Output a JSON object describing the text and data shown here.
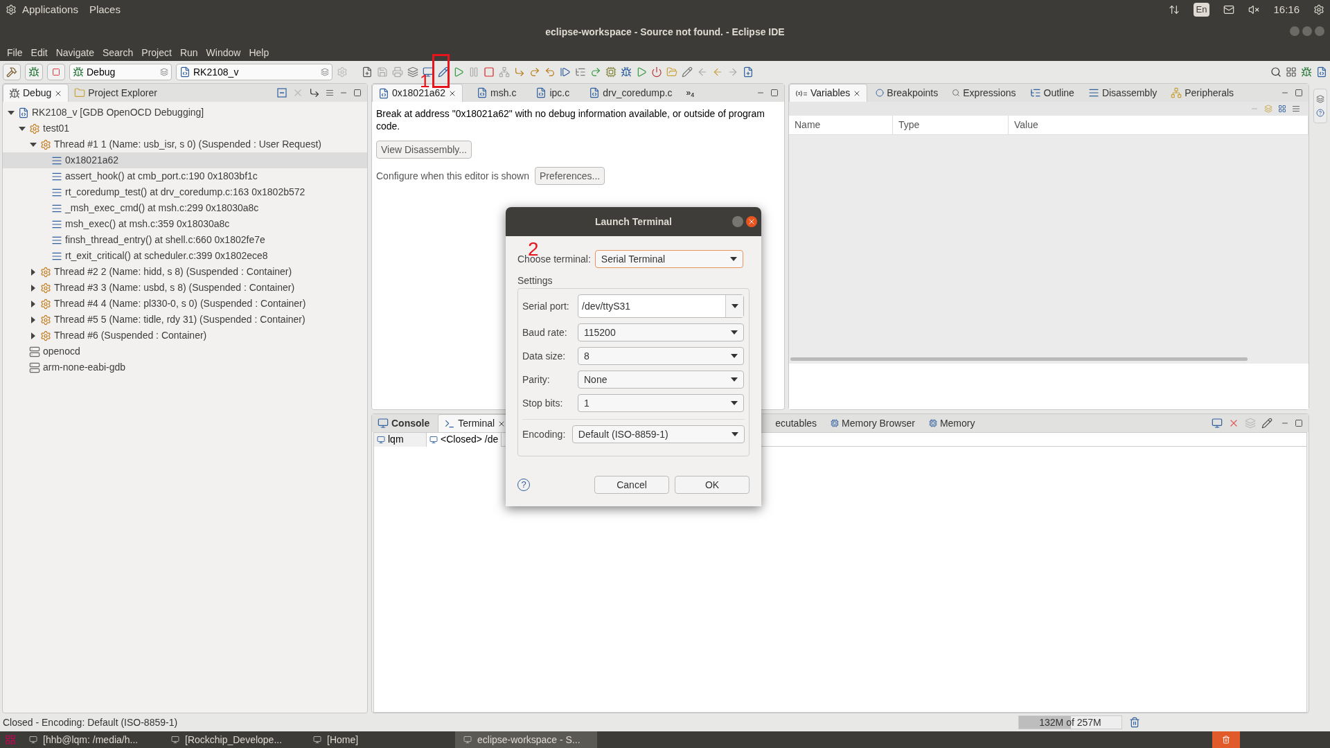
{
  "top_panel": {
    "menus": [
      "Applications",
      "Places"
    ],
    "keyboard": "En",
    "clock": "16:16"
  },
  "window": {
    "title": "eclipse-workspace - Source not found. - Eclipse IDE"
  },
  "menu_bar": [
    "File",
    "Edit",
    "Navigate",
    "Search",
    "Project",
    "Run",
    "Window",
    "Help"
  ],
  "toolbar": {
    "perspective": "Debug",
    "launch_config": "RK2108_v"
  },
  "debug_view": {
    "tabs": [
      {
        "label": "Debug",
        "selected": true
      },
      {
        "label": "Project Explorer",
        "selected": false
      }
    ],
    "tree": [
      {
        "kind": "launch",
        "label": "RK2108_v [GDB OpenOCD Debugging]",
        "expanded": true,
        "selected": false,
        "children": [
          {
            "kind": "target",
            "label": "test01",
            "expanded": true,
            "selected": false,
            "children": [
              {
                "kind": "thread",
                "label": "Thread #1 1 (Name: usb_isr, s 0) (Suspended : User Request)",
                "expanded": true,
                "selected": false,
                "children": [
                  {
                    "kind": "frame",
                    "label": "0x18021a62",
                    "selected": true
                  },
                  {
                    "kind": "frame",
                    "label": "assert_hook() at cmb_port.c:190 0x1803bf1c",
                    "selected": false
                  },
                  {
                    "kind": "frame",
                    "label": "rt_coredump_test() at drv_coredump.c:163 0x1802b572",
                    "selected": false
                  },
                  {
                    "kind": "frame",
                    "label": "_msh_exec_cmd() at msh.c:299 0x18030a8c",
                    "selected": false
                  },
                  {
                    "kind": "frame",
                    "label": "msh_exec() at msh.c:359 0x18030a8c",
                    "selected": false
                  },
                  {
                    "kind": "frame",
                    "label": "finsh_thread_entry() at shell.c:660 0x1802fe7e",
                    "selected": false
                  },
                  {
                    "kind": "frame",
                    "label": "rt_exit_critical() at scheduler.c:399 0x1802ece8",
                    "selected": false
                  }
                ]
              },
              {
                "kind": "thread",
                "label": "Thread #2 2 (Name: hidd, s 8) (Suspended : Container)",
                "expanded": false,
                "selected": false
              },
              {
                "kind": "thread",
                "label": "Thread #3 3 (Name: usbd, s 8) (Suspended : Container)",
                "expanded": false,
                "selected": false
              },
              {
                "kind": "thread",
                "label": "Thread #4 4 (Name: pl330-0, s 0) (Suspended : Container)",
                "expanded": false,
                "selected": false
              },
              {
                "kind": "thread",
                "label": "Thread #5 5 (Name: tidle, rdy 31) (Suspended : Container)",
                "expanded": false,
                "selected": false
              },
              {
                "kind": "thread",
                "label": "Thread #6 (Suspended : Container)",
                "expanded": false,
                "selected": false
              }
            ]
          },
          {
            "kind": "process",
            "label": "openocd",
            "selected": false
          },
          {
            "kind": "process",
            "label": "arm-none-eabi-gdb",
            "selected": false
          }
        ]
      }
    ]
  },
  "editor": {
    "tabs": [
      {
        "label": "0x18021a62",
        "selected": true
      },
      {
        "label": "msh.c",
        "selected": false
      },
      {
        "label": "ipc.c",
        "selected": false
      },
      {
        "label": "drv_coredump.c",
        "selected": false
      }
    ],
    "overflow": "»$_{4}$",
    "message": "Break at address \"0x18021a62\" with no debug information available, or outside of program code.",
    "view_button": "View Disassembly...",
    "configure_text": "Configure when this editor is shown",
    "preferences_button": "Preferences..."
  },
  "variables_view": {
    "tabs": [
      {
        "label": "Variables",
        "selected": true
      },
      {
        "label": "Breakpoints",
        "selected": false
      },
      {
        "label": "Expressions",
        "selected": false
      },
      {
        "label": "Outline",
        "selected": false
      },
      {
        "label": "Disassembly",
        "selected": false
      },
      {
        "label": "Peripherals",
        "selected": false
      }
    ],
    "columns": [
      "Name",
      "Type",
      "Value"
    ]
  },
  "bottom_view": {
    "tabs": [
      {
        "label": "Console",
        "selected": false,
        "changed": true
      },
      {
        "label": "Terminal",
        "selected": true,
        "changed": false
      },
      {
        "label": "ecutables",
        "selected": false,
        "changed": false
      },
      {
        "label": "Memory Browser",
        "selected": false,
        "changed": false
      },
      {
        "label": "Memory",
        "selected": false,
        "changed": false
      }
    ],
    "terminal_tabs": [
      {
        "label": "lqm",
        "selected": false
      },
      {
        "label": "<Closed> /de",
        "selected": true
      }
    ]
  },
  "dialog": {
    "title": "Launch Terminal",
    "choose_label": "Choose terminal:",
    "choose_value": "Serial Terminal",
    "group": "Settings",
    "fields": [
      {
        "kind": "editable",
        "label": "Serial port:",
        "value": "/dev/ttyS31"
      },
      {
        "kind": "combo",
        "label": "Baud rate:",
        "value": "115200"
      },
      {
        "kind": "combo",
        "label": "Data size:",
        "value": "8"
      },
      {
        "kind": "combo",
        "label": "Parity:",
        "value": "None"
      },
      {
        "kind": "combo",
        "label": "Stop bits:",
        "value": "1"
      }
    ],
    "encoding_label": "Encoding:",
    "encoding_value": "Default (ISO-8859-1)",
    "help": "?",
    "buttons": [
      "Cancel",
      "OK"
    ]
  },
  "annotations": [
    {
      "text": "1"
    },
    {
      "text": "2"
    }
  ],
  "status_bar": {
    "text": "Closed - Encoding: Default (ISO-8859-1)",
    "heap": {
      "text": "132M of 257M",
      "level": 0.51
    }
  },
  "taskbar": [
    {
      "label": "[hhb@lqm: /media/h...",
      "selected": false
    },
    {
      "label": "[Rockchip_Develope...",
      "selected": false
    },
    {
      "label": "[Home]",
      "selected": false
    },
    {
      "label": "eclipse-workspace - S...",
      "selected": true
    }
  ]
}
